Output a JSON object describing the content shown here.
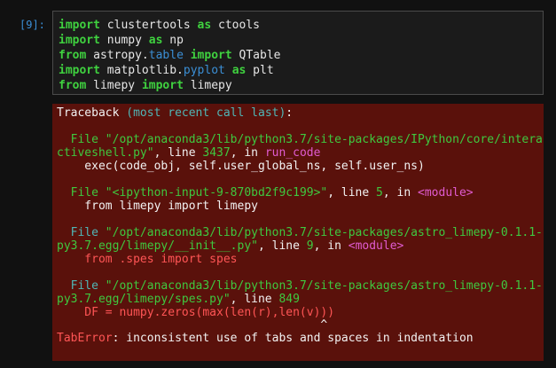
{
  "prompt": "[9]:",
  "code": {
    "l1": {
      "k1": "import",
      "t1": " clustertools ",
      "k2": "as",
      "t2": " ctools"
    },
    "l2": {
      "k1": "import",
      "t1": " numpy ",
      "k2": "as",
      "t2": " np"
    },
    "l3": {
      "k1": "from",
      "t1": " astropy.",
      "mod": "table",
      "t2": " ",
      "k2": "import",
      "t3": " QTable"
    },
    "l4": {
      "k1": "import",
      "t1": " matplotlib.",
      "mod": "pyplot",
      "t2": " ",
      "k2": "as",
      "t3": " plt"
    },
    "l5": {
      "k1": "from",
      "t1": " limepy ",
      "k2": "import",
      "t2": " limepy"
    }
  },
  "traceback": {
    "header": {
      "a": "Traceback ",
      "b": "(most recent call last)",
      "c": ":"
    },
    "f1": {
      "l1": {
        "a": "  File ",
        "b": "\"/opt/anaconda3/lib/python3.7/site-packages/IPython/core/intera"
      },
      "l2": {
        "a": "ctiveshell.py\"",
        "b": ", line ",
        "c": "3437",
        "d": ", in ",
        "e": "run_code"
      },
      "l3": "    exec(code_obj, self.user_global_ns, self.user_ns)"
    },
    "f2": {
      "l1": {
        "a": "  File ",
        "b": "\"<ipython-input-9-870bd2f9c199>\"",
        "c": ", line ",
        "d": "5",
        "e": ", in ",
        "f": "<module>"
      },
      "l2": "    from limepy import limepy"
    },
    "f3": {
      "l1": {
        "a": "  File ",
        "b": "\"/opt/anaconda3/lib/python3.7/site-packages/astro_limepy-0.1.1-"
      },
      "l2": {
        "a": "py3.7.egg/limepy/__init__.py\"",
        "b": ", line ",
        "c": "9",
        "d": ", in ",
        "e": "<module>"
      },
      "l3": "    from .spes import spes"
    },
    "f4": {
      "l1": {
        "a": "  File ",
        "b": "\"/opt/anaconda3/lib/python3.7/site-packages/astro_limepy-0.1.1-"
      },
      "l2": {
        "a": "py3.7.egg/limepy/spes.py\"",
        "b": ", line ",
        "c": "849"
      },
      "l3": "    DF = numpy.zeros(max(len(r),len(v)))",
      "l4": "                                      ^"
    },
    "error": {
      "name": "TabError",
      "msg": ": inconsistent use of tabs and spaces in indentation"
    }
  }
}
